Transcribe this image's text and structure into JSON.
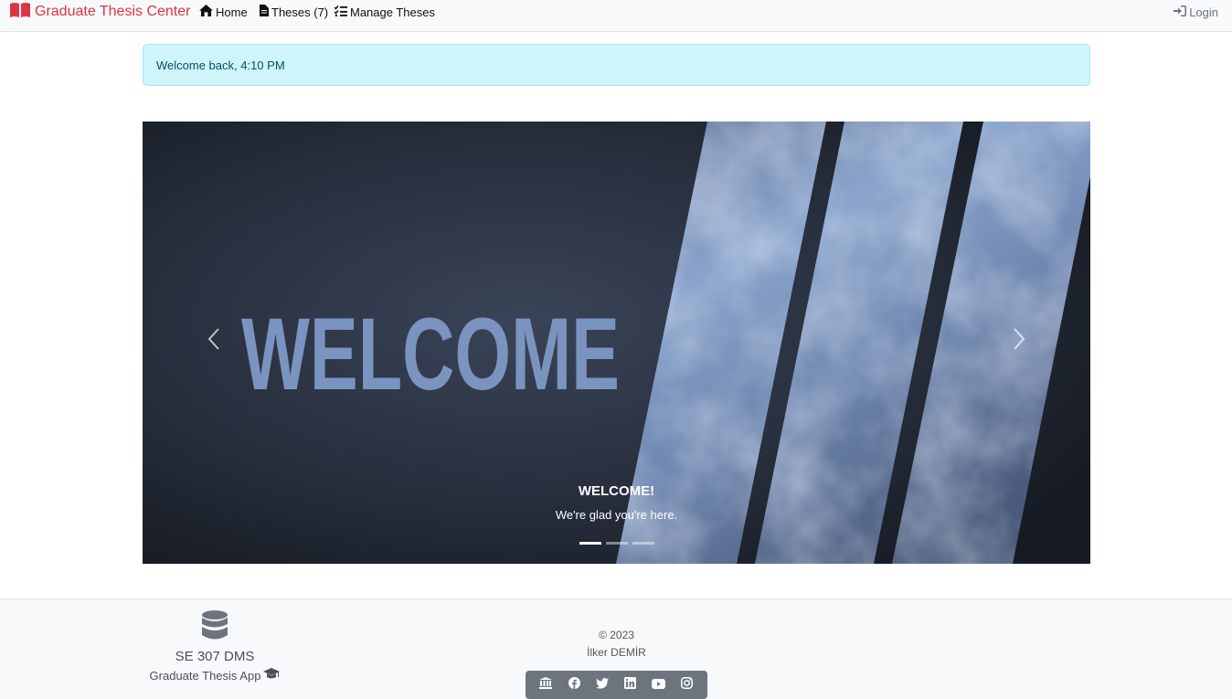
{
  "navbar": {
    "brand": "Graduate Thesis Center",
    "items": [
      {
        "label": "Home",
        "icon": "home-icon"
      },
      {
        "label": "Theses (7)",
        "icon": "file-icon"
      },
      {
        "label": "Manage Theses",
        "icon": "list-check-icon"
      }
    ],
    "login": "Login"
  },
  "alert": {
    "text": "Welcome back, 4:10 PM"
  },
  "carousel": {
    "image_text": "WELCOME",
    "caption_title": "WELCOME!",
    "caption_text": "We're glad you're here.",
    "slide_count": 3,
    "active_slide": 1
  },
  "footer": {
    "app_name": "SE 307 DMS",
    "app_subtitle": "Graduate Thesis App",
    "copyright": "© 2023",
    "author": "İlker DEMİR",
    "social": [
      "institution-icon",
      "facebook-icon",
      "twitter-icon",
      "linkedin-icon",
      "youtube-icon",
      "instagram-icon"
    ]
  },
  "colors": {
    "brand": "#dc3545",
    "alert_bg": "#cff4fc",
    "alert_text": "#055160",
    "footer_bg": "#f8f9fa",
    "social_bg": "#6c757d"
  }
}
